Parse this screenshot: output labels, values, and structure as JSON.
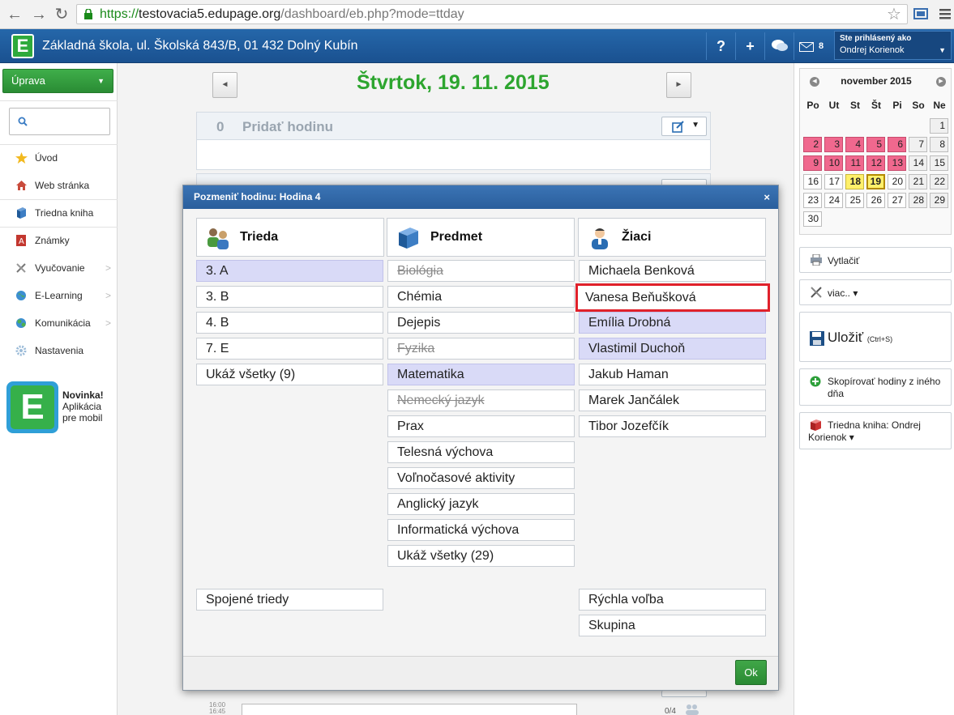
{
  "browser": {
    "url_scheme": "https://",
    "url_host": "testovacia5.edupage.org",
    "url_path": "/dashboard/eb.php?mode=ttday"
  },
  "header": {
    "logo_letter": "E",
    "school": "Základná škola, ul. Školská 843/B, 01 432 Dolný Kubín",
    "help_label": "?",
    "add_label": "+",
    "messages_count": "8",
    "signed_in_label": "Ste prihlásený ako",
    "user_name": "Ondrej Korienok"
  },
  "sidebar": {
    "edit_button": "Úprava",
    "search_placeholder": "",
    "items": [
      {
        "label": "Úvod"
      },
      {
        "label": "Web stránka"
      },
      {
        "label": "Triedna kniha"
      },
      {
        "label": "Známky"
      },
      {
        "label": "Vyučovanie"
      },
      {
        "label": "E-Learning"
      },
      {
        "label": "Komunikácia"
      },
      {
        "label": "Nastavenia"
      }
    ],
    "promo": {
      "title": "Novinka!",
      "line1": "Aplikácia",
      "line2": "pre mobil"
    }
  },
  "main": {
    "day_title": "Štvrtok, 19. 11. 2015",
    "prev_label": "◄",
    "next_label": "►",
    "lesson0_num": "0",
    "lesson0_name": "Pridať hodinu",
    "bottom_time1": "16:00",
    "bottom_time2": "16:45",
    "bottom_count": "0/4"
  },
  "calendar": {
    "month": "november 2015",
    "dow": [
      "Po",
      "Ut",
      "St",
      "Št",
      "Pi",
      "So",
      "Ne"
    ],
    "weeks": [
      [
        null,
        null,
        null,
        null,
        null,
        null,
        "1"
      ],
      [
        "2",
        "3",
        "4",
        "5",
        "6",
        "7",
        "8"
      ],
      [
        "9",
        "10",
        "11",
        "12",
        "13",
        "14",
        "15"
      ],
      [
        "16",
        "17",
        "18",
        "19",
        "20",
        "21",
        "22"
      ],
      [
        "23",
        "24",
        "25",
        "26",
        "27",
        "28",
        "29"
      ],
      [
        "30",
        null,
        null,
        null,
        null,
        null,
        null
      ]
    ],
    "pink_days": [
      "2",
      "3",
      "4",
      "5",
      "6",
      "9",
      "10",
      "11",
      "12",
      "13"
    ],
    "yellow_day": "18",
    "today": "19",
    "weekend_days": [
      "1",
      "7",
      "8",
      "14",
      "15",
      "21",
      "22",
      "28",
      "29"
    ],
    "colors": {
      "pink": "#f0688e",
      "yellow": "#fff06a"
    }
  },
  "right_panel": {
    "print": "Vytlačiť",
    "more": "viac.. ▾",
    "save": "Uložiť",
    "save_shortcut": "(Ctrl+S)",
    "copy": "Skopírovať hodiny z iného dňa",
    "book": "Triedna kniha: Ondrej Korienok ▾"
  },
  "modal": {
    "title": "Pozmeniť hodinu: Hodina 4",
    "close": "×",
    "ok": "Ok",
    "classes": {
      "header": "Trieda",
      "items": [
        {
          "label": "3. A",
          "selected": true
        },
        {
          "label": "3. B"
        },
        {
          "label": "4. B"
        },
        {
          "label": "7. E"
        },
        {
          "label": "Ukáž všetky (9)"
        }
      ],
      "joined": "Spojené triedy"
    },
    "subjects": {
      "header": "Predmet",
      "items": [
        {
          "label": "Biológia",
          "strike": true
        },
        {
          "label": "Chémia"
        },
        {
          "label": "Dejepis"
        },
        {
          "label": "Fyzika",
          "strike": true
        },
        {
          "label": "Matematika",
          "selected": true
        },
        {
          "label": "Nemecký jazyk",
          "strike": true
        },
        {
          "label": "Prax"
        },
        {
          "label": "Telesná výchova"
        },
        {
          "label": "Voľnočasové aktivity"
        },
        {
          "label": "Anglický jazyk"
        },
        {
          "label": "Informatická výchova"
        },
        {
          "label": "Ukáž všetky (29)"
        }
      ]
    },
    "students": {
      "header": "Žiaci",
      "items": [
        {
          "label": "Michaela Benková"
        },
        {
          "label": "Vanesa Beňušková",
          "highlight": true
        },
        {
          "label": "Emília Drobná",
          "selected": true
        },
        {
          "label": "Vlastimil Duchoň",
          "selected": true
        },
        {
          "label": "Jakub Haman"
        },
        {
          "label": "Marek Jančálek"
        },
        {
          "label": "Tibor Jozefčík"
        }
      ],
      "quick": "Rýchla voľba",
      "group": "Skupina"
    }
  }
}
